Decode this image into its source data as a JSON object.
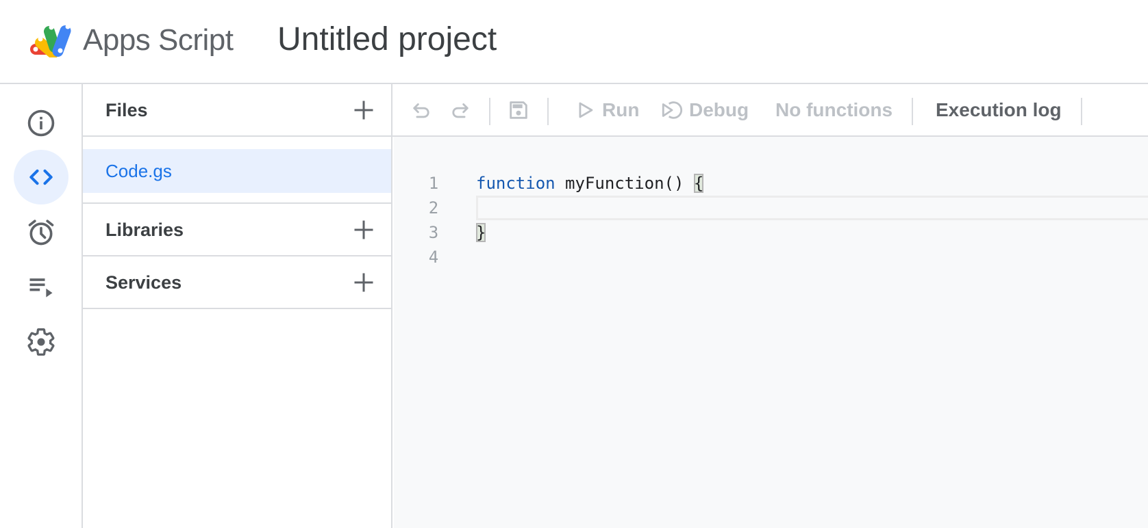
{
  "header": {
    "app_name": "Apps Script",
    "project_title": "Untitled project",
    "logo_colors": [
      "#ea4335",
      "#fbbc04",
      "#34a853",
      "#4285f4"
    ]
  },
  "nav_rail": {
    "items": [
      {
        "name": "overview",
        "icon": "info-icon",
        "active": false
      },
      {
        "name": "editor",
        "icon": "code-icon",
        "active": true
      },
      {
        "name": "triggers",
        "icon": "alarm-clock-icon",
        "active": false
      },
      {
        "name": "executions",
        "icon": "playlist-play-icon",
        "active": false
      },
      {
        "name": "project-settings",
        "icon": "gear-icon",
        "active": false
      }
    ],
    "active_color": "#1a73e8",
    "active_bg": "#e8f0fe"
  },
  "files_panel": {
    "files_title": "Files",
    "files": [
      {
        "name": "Code.gs",
        "selected": true
      }
    ],
    "libraries_title": "Libraries",
    "services_title": "Services"
  },
  "toolbar": {
    "undo_icon": "undo-icon",
    "redo_icon": "redo-icon",
    "save_icon": "save-icon",
    "run_label": "Run",
    "debug_label": "Debug",
    "function_select_value": "No functions",
    "execution_log_label": "Execution log"
  },
  "editor": {
    "lines": [
      {
        "number": "1",
        "keyword": "function",
        "rest": " myFunction() ",
        "bracket": "{"
      },
      {
        "number": "2",
        "text": ""
      },
      {
        "number": "3",
        "bracket": "}"
      },
      {
        "number": "4",
        "text": ""
      }
    ],
    "keyword_color": "#1558b0"
  }
}
